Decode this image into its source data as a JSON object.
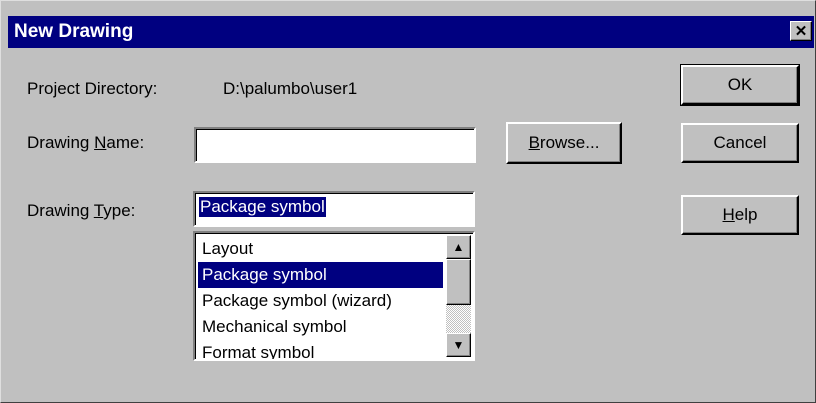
{
  "window": {
    "title": "New Drawing",
    "close_glyph": "✕"
  },
  "project": {
    "label": "Project Directory:",
    "value": "D:\\palumbo\\user1"
  },
  "drawing_name": {
    "label_pre": "Drawing ",
    "label_accel": "N",
    "label_post": "ame:",
    "value": ""
  },
  "drawing_type": {
    "label_pre": "Drawing ",
    "label_accel": "T",
    "label_post": "ype:",
    "value": "Package symbol",
    "options": [
      "Layout",
      "Package symbol",
      "Package symbol (wizard)",
      "Mechanical symbol",
      "Format symbol"
    ],
    "selected_index": 1
  },
  "buttons": {
    "ok": "OK",
    "cancel": "Cancel",
    "browse_accel": "B",
    "browse_rest": "rowse...",
    "help_accel": "H",
    "help_rest": "elp"
  },
  "colors": {
    "face": "#c0c0c0",
    "title_bar": "#000080",
    "highlight": "#000080"
  },
  "icons": {
    "close": "close-icon",
    "scroll_up": "arrow-up-icon",
    "scroll_down": "arrow-down-icon"
  }
}
